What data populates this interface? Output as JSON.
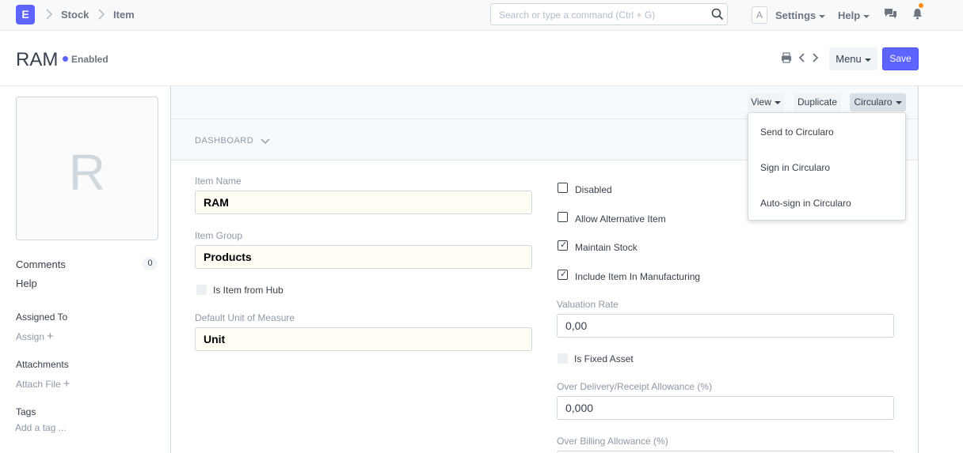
{
  "navbar": {
    "logo": "E",
    "breadcrumbs": [
      "Stock",
      "Item"
    ],
    "search_placeholder": "Search or type a command (Ctrl + G)",
    "avatar": "A",
    "settings": "Settings",
    "help": "Help"
  },
  "page": {
    "title": "RAM",
    "status": "Enabled",
    "menu_label": "Menu",
    "save_label": "Save"
  },
  "sidebar": {
    "image_letter": "R",
    "comments": "Comments",
    "comments_count": "0",
    "help": "Help",
    "assigned_to": "Assigned To",
    "assign": "Assign",
    "attachments": "Attachments",
    "attach_file": "Attach File",
    "tags": "Tags",
    "add_tag": "Add a tag ..."
  },
  "toolbar": {
    "view": "View",
    "duplicate": "Duplicate",
    "circularo": "Circularo"
  },
  "dashboard_label": "DASHBOARD",
  "form": {
    "item_name_label": "Item Name",
    "item_name": "RAM",
    "item_group_label": "Item Group",
    "item_group": "Products",
    "is_item_from_hub": "Is Item from Hub",
    "uom_label": "Default Unit of Measure",
    "uom": "Unit",
    "disabled": "Disabled",
    "allow_alt": "Allow Alternative Item",
    "maintain_stock": "Maintain Stock",
    "include_mfg": "Include Item In Manufacturing",
    "valuation_rate_label": "Valuation Rate",
    "valuation_rate": "0,00",
    "is_fixed_asset": "Is Fixed Asset",
    "over_delivery_label": "Over Delivery/Receipt Allowance (%)",
    "over_delivery": "0,000",
    "over_billing_label": "Over Billing Allowance (%)"
  },
  "dropdown": {
    "items": [
      "Send to Circularo",
      "Sign in Circularo",
      "Auto-sign in Circularo"
    ]
  },
  "colors": {
    "primary": "#5e64ff",
    "notification": "#ff8c1a"
  }
}
